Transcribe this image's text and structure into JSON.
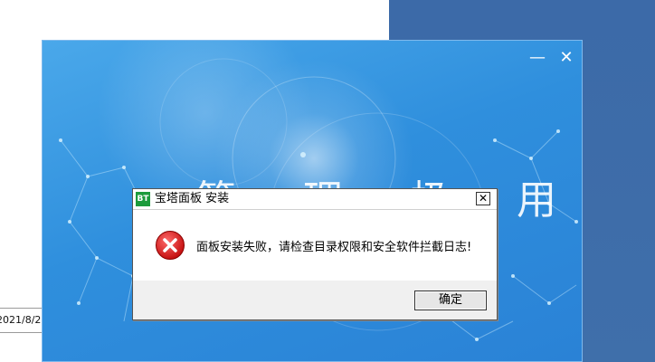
{
  "background_window": {
    "partial_date": "2021/8/2"
  },
  "installer": {
    "title_text": "管 理 极 用",
    "minimize_symbol": "—",
    "close_symbol": "✕",
    "colors": {
      "primary": "#2f8fdd"
    }
  },
  "dialog": {
    "app_icon_text": "BT",
    "title": "宝塔面板 安装",
    "close_symbol": "✕",
    "icon": "error-icon",
    "message": "面板安装失败，请检查目录权限和安全软件拦截日志!",
    "ok_label": "确定"
  }
}
